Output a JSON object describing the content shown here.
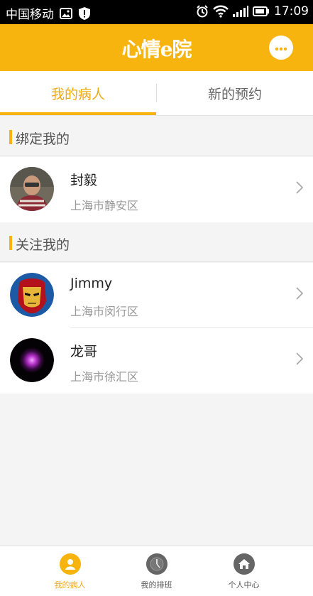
{
  "status_bar": {
    "carrier": "中国移动",
    "time": "17:09",
    "icons": [
      "image-icon",
      "shield-alert-icon",
      "alarm-icon",
      "wifi-icon",
      "signal-icon",
      "battery-icon"
    ]
  },
  "header": {
    "logo_text": "心情e院",
    "chat_icon": "chat-bubble-icon"
  },
  "tabs": [
    {
      "label": "我的病人",
      "active": true
    },
    {
      "label": "新的预约",
      "active": false
    }
  ],
  "sections": [
    {
      "title": "绑定我的",
      "patients": [
        {
          "name": "封毅",
          "city": "上海市静安区"
        }
      ]
    },
    {
      "title": "关注我的",
      "patients": [
        {
          "name": "Jimmy",
          "city": "上海市闵行区"
        },
        {
          "name": "龙哥",
          "city": "上海市徐汇区"
        }
      ]
    }
  ],
  "bottom_nav": [
    {
      "label": "我的病人",
      "icon": "person-icon",
      "active": true
    },
    {
      "label": "我的排班",
      "icon": "clock-icon",
      "active": false
    },
    {
      "label": "个人中心",
      "icon": "home-icon",
      "active": false
    }
  ],
  "colors": {
    "accent": "#f7b40f",
    "active_text": "#f0aa12",
    "background": "#f4f4f4"
  }
}
